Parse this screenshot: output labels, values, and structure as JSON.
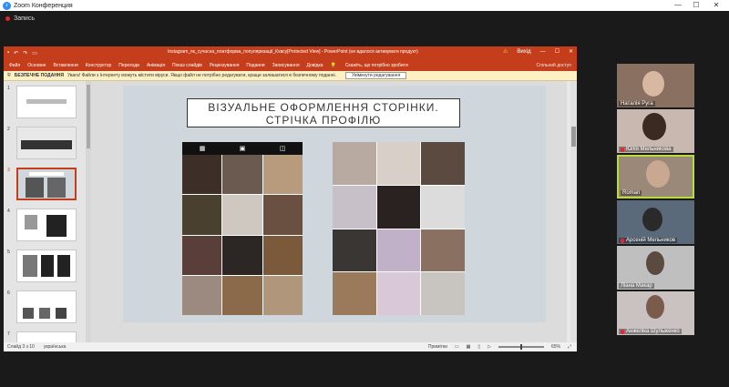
{
  "window": {
    "title": "Zoom Конференция",
    "minimize": "—",
    "maximize": "☐",
    "close": "✕"
  },
  "recording": {
    "label": "Запись"
  },
  "ppt": {
    "doc_title": "Instagram_як_сучасна_платформа_популяризації_Кхвсу[Protected View] - PowerPoint (не вдалося активувати продукт)",
    "signin": "Вихід",
    "warn_icon": "warning-icon",
    "menu": [
      "Файл",
      "Основне",
      "Вставлення",
      "Конструктор",
      "Переходи",
      "Анімація",
      "Показ слайдів",
      "Рецензування",
      "Подання",
      "Записування",
      "Довідка"
    ],
    "tell_me": "Скажіть, що потрібно зробити",
    "share": "Спільний доступ",
    "protected_bar": {
      "label": "БЕЗПЕЧНЕ ПОДАННЯ",
      "text": "Увага! Файли з Інтернету можуть містити віруси. Якщо файл не потрібно редагувати, краще залишатися в безпечному поданні.",
      "button": "Увімкнути редагування"
    },
    "thumbnails": [
      "1",
      "2",
      "3",
      "4",
      "5",
      "6",
      "7"
    ],
    "selected_slide": 3,
    "slide": {
      "title_line1": "ВІЗУАЛЬНЕ ОФОРМЛЕННЯ СТОРІНКИ.",
      "title_line2": "СТРІЧКА ПРОФІЛЮ"
    },
    "status": {
      "slide": "Слайд 3 з 10",
      "lang": "українська",
      "notes": "Примітки",
      "zoom": "65%"
    }
  },
  "participants": [
    {
      "name": "Наталія Руга",
      "color": "#8a7060"
    },
    {
      "name": "Юлія Мельникова",
      "color": "#c8b8b0"
    },
    {
      "name": "Roman",
      "color": "#9a8878",
      "active": true
    },
    {
      "name": "Арсеній Мельников",
      "color": "#5a6a7a"
    },
    {
      "name": "Ліана Макар",
      "color": "#bfbfbf"
    },
    {
      "name": "Анжеліка Шульженко",
      "color": "#c9c2c0"
    }
  ],
  "colors": {
    "ppt_accent": "#c43e1c",
    "active_speaker": "#b8dc3a",
    "zoom_blue": "#2d8cff"
  }
}
